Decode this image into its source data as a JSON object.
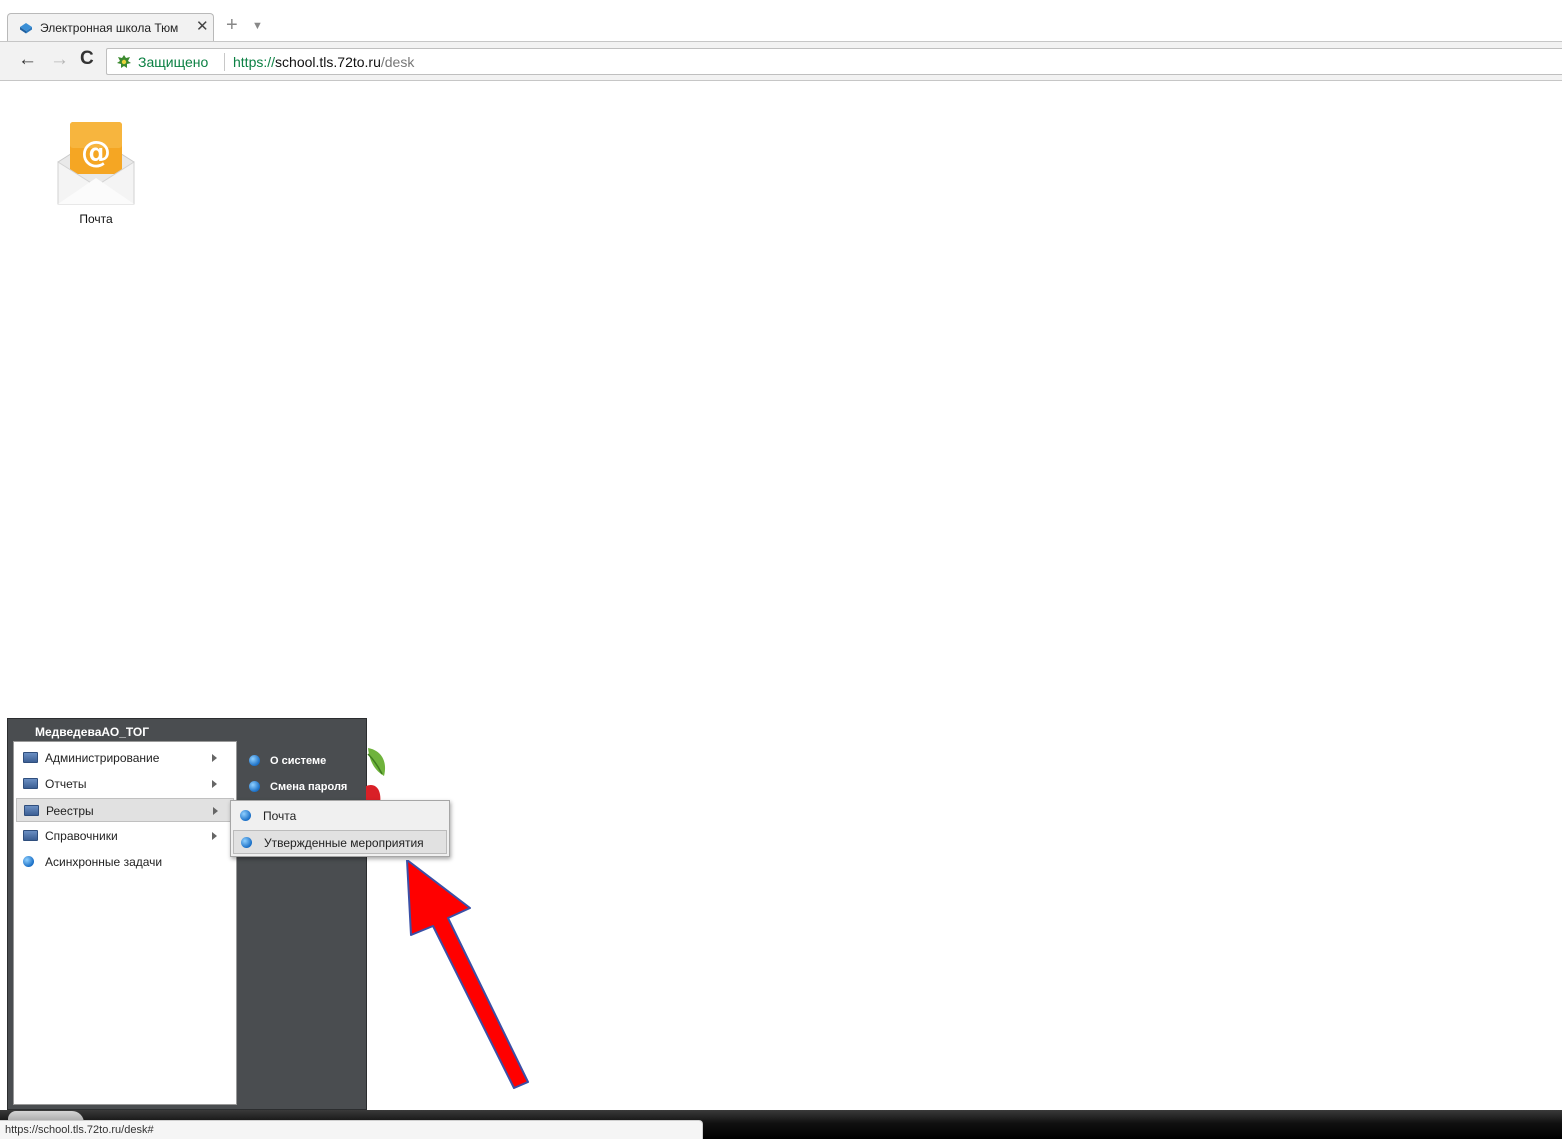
{
  "browser": {
    "tab_title": "Электронная школа Тюм",
    "tab_close_glyph": "✕",
    "new_tab_glyph": "+",
    "tab_menu_glyph": "▼",
    "nav": {
      "back_glyph": "←",
      "forward_glyph": "→",
      "reload_glyph": "C"
    },
    "secure_label": "Защищено",
    "url": {
      "scheme": "https://",
      "host": "school.tls.72to.ru",
      "path": "/desk"
    },
    "status_url": "https://school.tls.72to.ru/desk#",
    "icons": [
      "app-favicon-icon",
      "secure-lock-icon"
    ]
  },
  "desktop": {
    "icons": [
      {
        "label": "Почта",
        "icon": "mail-envelope-icon"
      }
    ]
  },
  "start_menu": {
    "user": "МедведеваАО_ТОГ",
    "items": [
      {
        "label": "Администрирование",
        "icon": "folder-icon",
        "has_submenu": true
      },
      {
        "label": "Отчеты",
        "icon": "folder-icon",
        "has_submenu": true
      },
      {
        "label": "Реестры",
        "icon": "folder-icon",
        "has_submenu": true,
        "active": true
      },
      {
        "label": "Справочники",
        "icon": "folder-icon",
        "has_submenu": true
      },
      {
        "label": "Асинхронные задачи",
        "icon": "dot-icon",
        "has_submenu": false
      }
    ],
    "right_items": [
      {
        "label": "О системе",
        "icon": "dot-icon"
      },
      {
        "label": "Смена пароля",
        "icon": "dot-icon"
      }
    ],
    "submenu": [
      {
        "label": "Почта",
        "icon": "dot-icon"
      },
      {
        "label": "Утвержденные мероприятия",
        "icon": "dot-icon",
        "active": true
      }
    ]
  },
  "colors": {
    "menu_panel": "#4a4d50",
    "secure_green": "#0b8043",
    "annotation_arrow": "#ff0000",
    "mail_icon_orange": "#f5a623",
    "menu_dot_blue": "#1a6fc6"
  }
}
